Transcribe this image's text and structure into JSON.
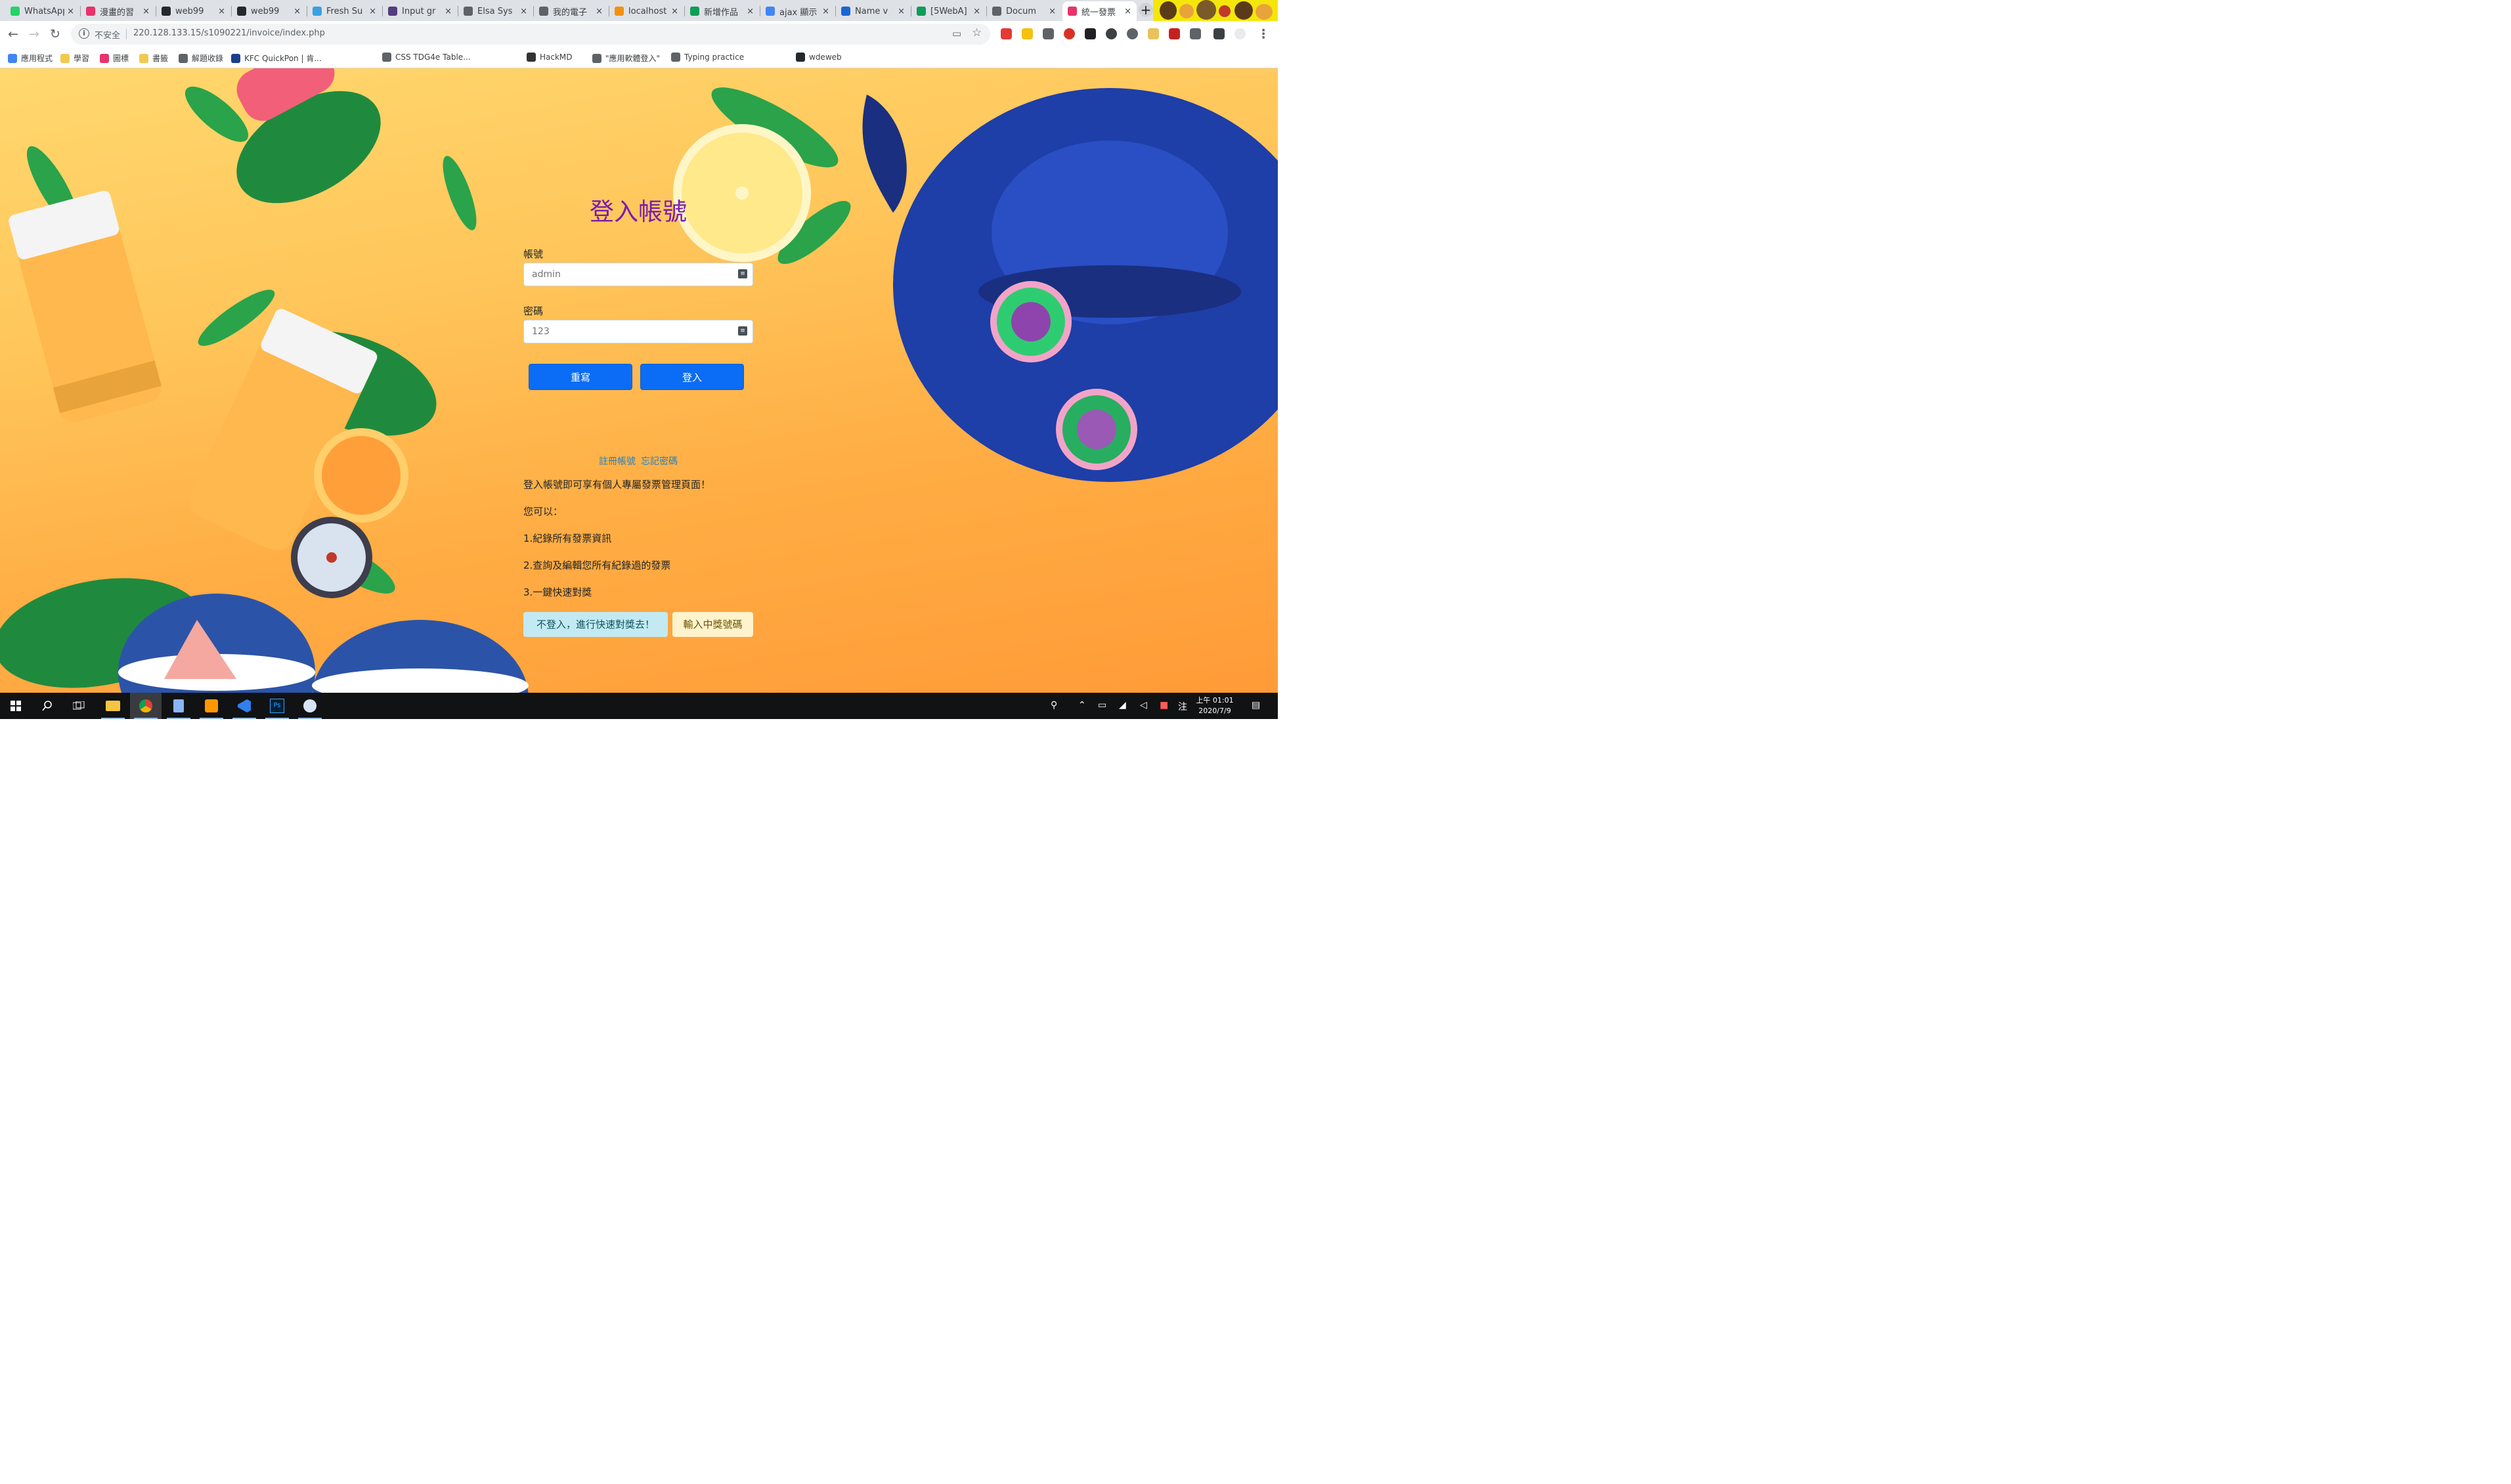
{
  "browser": {
    "tabs": [
      {
        "title": "WhatsApp",
        "color": "#25d366"
      },
      {
        "title": "漫畫的習",
        "color": "#e8336d"
      },
      {
        "title": "web99",
        "color": "#24292e"
      },
      {
        "title": "web99",
        "color": "#24292e"
      },
      {
        "title": "Fresh Su",
        "color": "#3aa1e0"
      },
      {
        "title": "Input gr",
        "color": "#563d7c"
      },
      {
        "title": "Elsa Sys",
        "color": "#5f6368"
      },
      {
        "title": "我的電子",
        "color": "#5f6368"
      },
      {
        "title": "localhost",
        "color": "#f29111"
      },
      {
        "title": "新增作品",
        "color": "#0f9d58"
      },
      {
        "title": "ajax 顯示",
        "color": "#4285f4"
      },
      {
        "title": "Name v",
        "color": "#1967d2"
      },
      {
        "title": "[5WebA]",
        "color": "#0f9d58"
      },
      {
        "title": "Docum",
        "color": "#5f6368"
      },
      {
        "title": "統一發票",
        "color": "#e8336d",
        "active": true
      }
    ],
    "new_tab_symbol": "+",
    "close_symbol": "×",
    "nav": {
      "back": "←",
      "forward": "→",
      "reload": "↻"
    },
    "omnibox": {
      "security_label": "不安全",
      "url": "220.128.133.15/s1090221/invoice/index.php",
      "info_icon": "i",
      "star_icon": "☆",
      "cast_icon": "▭"
    },
    "menu_icon": "⋮",
    "bookmarks": [
      {
        "label": "應用程式",
        "color": "#4285f4"
      },
      {
        "label": "學習",
        "color": "#f2c94c"
      },
      {
        "label": "圖標",
        "color": "#e8336d"
      },
      {
        "label": "書籤",
        "color": "#f2c94c"
      },
      {
        "label": "解題收錄",
        "color": "#5f6368"
      },
      {
        "label": "KFC QuickPon | 肯...",
        "color": "#1a3d8f"
      },
      {
        "label": "CSS TDG4e Table...",
        "color": "#5f6368"
      },
      {
        "label": "HackMD",
        "color": "#333333"
      },
      {
        "label": "\"應用軟體登入\"",
        "color": "#5f6368"
      },
      {
        "label": "Typing practice",
        "color": "#5f6368"
      },
      {
        "label": "wdeweb",
        "color": "#24292e"
      }
    ]
  },
  "login": {
    "title": "登入帳號",
    "account_label": "帳號",
    "account_placeholder": "admin",
    "password_label": "密碼",
    "password_placeholder": "123",
    "reset_button": "重寫",
    "login_button": "登入",
    "register_link": "註冊帳號",
    "forgot_link": "忘記密碼",
    "intro": "登入帳號即可享有個人專屬發票管理頁面！",
    "you_can": "您可以：",
    "features": [
      "1.紀錄所有發票資訊",
      "2.查詢及編輯您所有紀錄過的發票",
      "3.一鍵快速對獎"
    ],
    "quick_check_button": "不登入，進行快速對獎去！",
    "winning_numbers_button": "輸入中獎號碼"
  },
  "taskbar": {
    "time": "上午 01:01",
    "date": "2020/7/9",
    "ime": "注",
    "apps": [
      "start",
      "search",
      "task-view",
      "file-explorer",
      "chrome",
      "notepad",
      "sublime",
      "vscode",
      "photoshop",
      "app"
    ]
  }
}
